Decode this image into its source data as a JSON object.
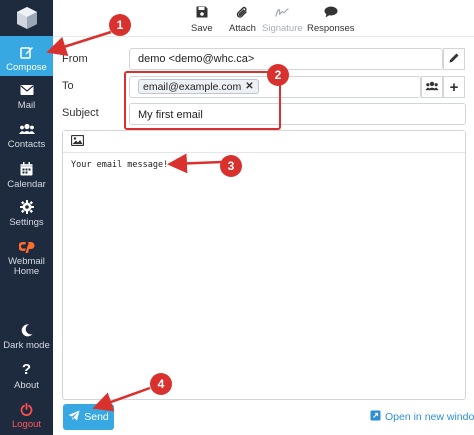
{
  "sidebar": {
    "items": [
      {
        "label": "Compose",
        "icon": "compose-icon"
      },
      {
        "label": "Mail",
        "icon": "mail-icon"
      },
      {
        "label": "Contacts",
        "icon": "contacts-icon"
      },
      {
        "label": "Calendar",
        "icon": "calendar-icon"
      },
      {
        "label": "Settings",
        "icon": "gear-icon"
      },
      {
        "label": "Webmail Home",
        "icon": "cpanel-icon"
      },
      {
        "label": "Dark mode",
        "icon": "moon-icon"
      },
      {
        "label": "About",
        "icon": "question-icon"
      },
      {
        "label": "Logout",
        "icon": "power-icon"
      }
    ]
  },
  "toolbar": {
    "save": "Save",
    "attach": "Attach",
    "signature": "Signature",
    "responses": "Responses"
  },
  "form": {
    "from_label": "From",
    "from_value": "demo <demo@whc.ca>",
    "to_label": "To",
    "to_recipient": "email@example.com",
    "subject_label": "Subject",
    "subject_value": "My first email",
    "body": "Your email message!"
  },
  "actions": {
    "send": "Send",
    "open_new_window": "Open in new window"
  },
  "annotations": [
    "1",
    "2",
    "3",
    "4"
  ],
  "colors": {
    "sidebar_bg": "#1e2a3d",
    "accent": "#37a8e1",
    "annotation_red": "#d9322e"
  }
}
